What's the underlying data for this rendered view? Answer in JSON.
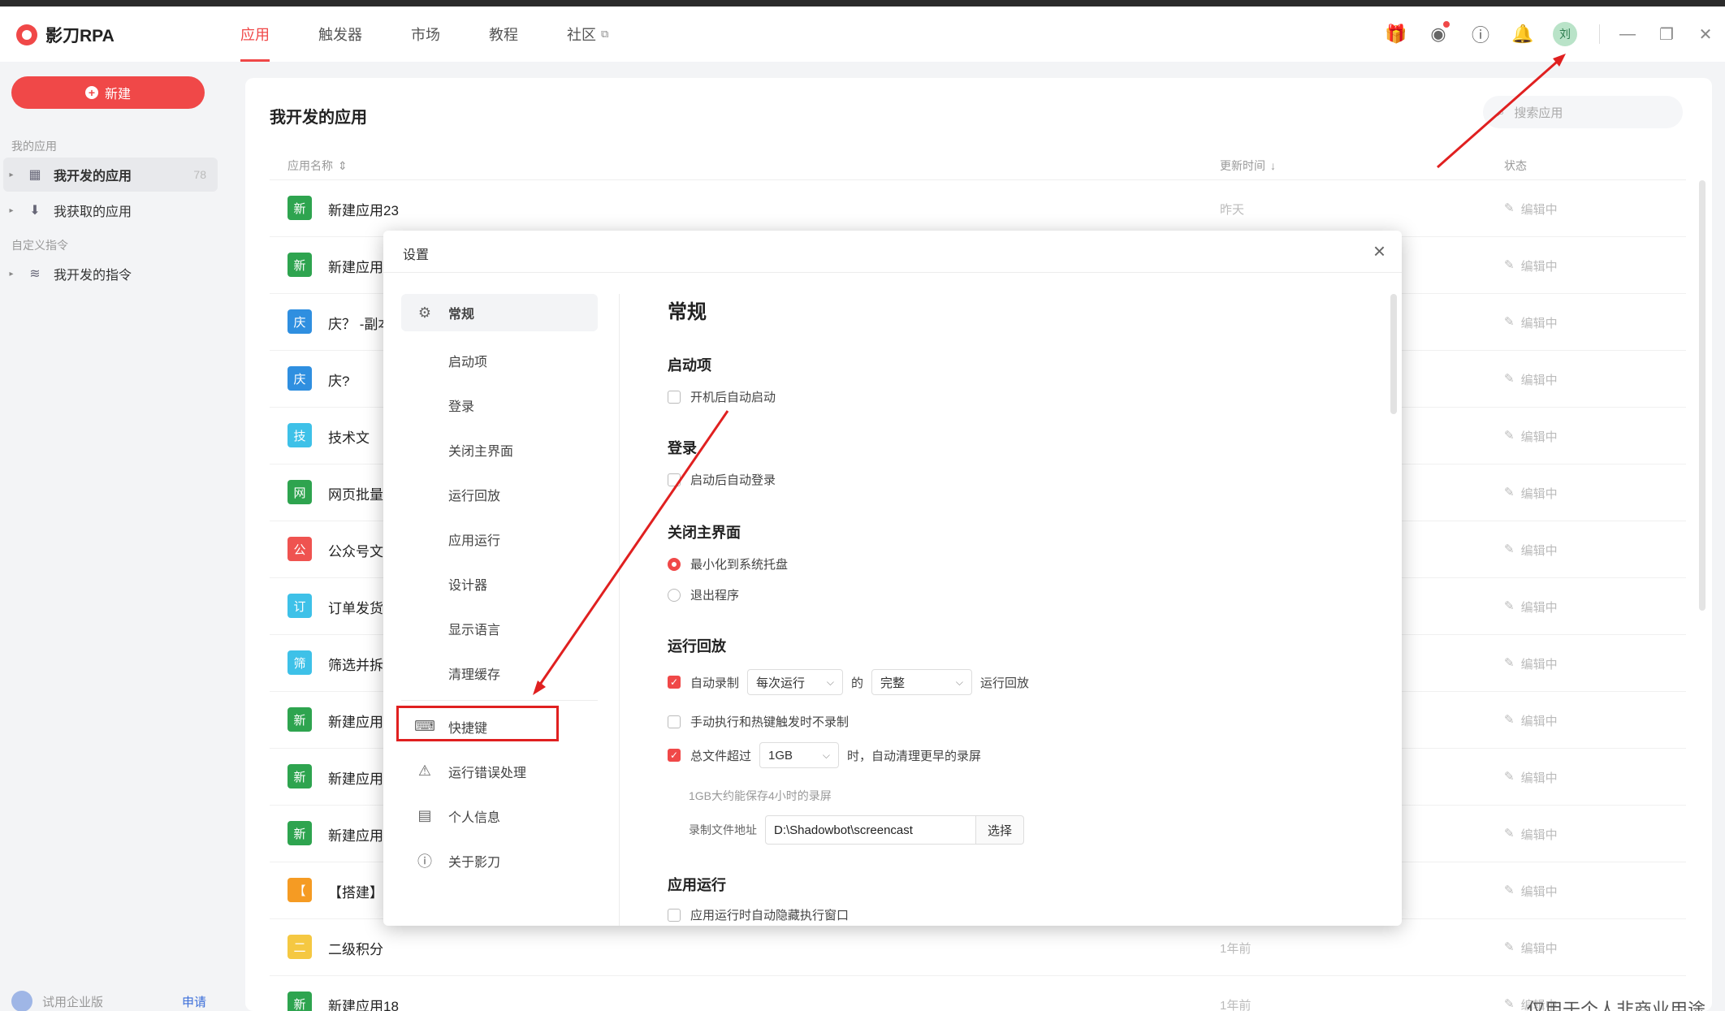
{
  "app": {
    "logo_text": "影刀RPA"
  },
  "nav": [
    {
      "label": "应用",
      "active": true
    },
    {
      "label": "触发器",
      "active": false
    },
    {
      "label": "市场",
      "active": false
    },
    {
      "label": "教程",
      "active": false
    },
    {
      "label": "社区",
      "active": false,
      "external": true
    }
  ],
  "topbar": {
    "avatar_text": "刘"
  },
  "sidebar": {
    "new_label": "新建",
    "section_my_apps": "我的应用",
    "items": [
      {
        "label": "我开发的应用",
        "count": "78",
        "active": true,
        "icon": "grid-icon"
      },
      {
        "label": "我获取的应用",
        "count": "",
        "active": false,
        "icon": "download-icon"
      }
    ],
    "section_custom": "自定义指令",
    "custom_items": [
      {
        "label": "我开发的指令",
        "icon": "layers-icon"
      }
    ],
    "trial_text": "试用企业版",
    "trial_link": "申请"
  },
  "main": {
    "title": "我开发的应用",
    "search_placeholder": "搜索应用",
    "col_name": "应用名称",
    "col_time": "更新时间",
    "col_status": "状态",
    "rows": [
      {
        "badge": "新",
        "color": "#2ea44f",
        "name": "新建应用23",
        "time": "昨天",
        "status": "编辑中"
      },
      {
        "badge": "新",
        "color": "#2ea44f",
        "name": "新建应用",
        "time": "",
        "status": "编辑中"
      },
      {
        "badge": "庆",
        "color": "#2f8fe0",
        "name": "庆？ -副本",
        "time": "",
        "status": "编辑中"
      },
      {
        "badge": "庆",
        "color": "#2f8fe0",
        "name": "庆?",
        "time": "",
        "status": "编辑中"
      },
      {
        "badge": "技",
        "color": "#3ec1e8",
        "name": "技术文",
        "time": "",
        "status": "编辑中"
      },
      {
        "badge": "网",
        "color": "#2ea44f",
        "name": "网页批量",
        "time": "",
        "status": "编辑中"
      },
      {
        "badge": "公",
        "color": "#ef5350",
        "name": "公众号文",
        "time": "",
        "status": "编辑中"
      },
      {
        "badge": "订",
        "color": "#3ec1e8",
        "name": "订单发货",
        "time": "",
        "status": "编辑中"
      },
      {
        "badge": "筛",
        "color": "#3ec1e8",
        "name": "筛选并拆",
        "time": "",
        "status": "编辑中"
      },
      {
        "badge": "新",
        "color": "#2ea44f",
        "name": "新建应用",
        "time": "",
        "status": "编辑中"
      },
      {
        "badge": "新",
        "color": "#2ea44f",
        "name": "新建应用",
        "time": "",
        "status": "编辑中"
      },
      {
        "badge": "新",
        "color": "#2ea44f",
        "name": "新建应用",
        "time": "",
        "status": "编辑中"
      },
      {
        "badge": "【",
        "color": "#f59b23",
        "name": "【搭建】",
        "time": "",
        "status": "编辑中"
      },
      {
        "badge": "二",
        "color": "#f5c842",
        "name": "二级积分",
        "time": "1年前",
        "status": "编辑中"
      },
      {
        "badge": "新",
        "color": "#2ea44f",
        "name": "新建应用18",
        "time": "1年前",
        "status": "编辑中"
      }
    ],
    "watermark": "仅用于个人非商业用途"
  },
  "modal": {
    "title": "设置",
    "nav": [
      {
        "label": "常规",
        "icon": "gear-icon",
        "type": "group",
        "selected": true
      },
      {
        "label": "启动项",
        "type": "sub"
      },
      {
        "label": "登录",
        "type": "sub"
      },
      {
        "label": "关闭主界面",
        "type": "sub"
      },
      {
        "label": "运行回放",
        "type": "sub"
      },
      {
        "label": "应用运行",
        "type": "sub"
      },
      {
        "label": "设计器",
        "type": "sub"
      },
      {
        "label": "显示语言",
        "type": "sub"
      },
      {
        "label": "清理缓存",
        "type": "sub"
      },
      {
        "label": "快捷键",
        "icon": "keyboard-icon",
        "type": "group",
        "highlighted": true
      },
      {
        "label": "运行错误处理",
        "icon": "warning-icon",
        "type": "group"
      },
      {
        "label": "个人信息",
        "icon": "id-card-icon",
        "type": "group"
      },
      {
        "label": "关于影刀",
        "icon": "info-icon",
        "type": "group"
      }
    ],
    "content": {
      "heading": "常规",
      "startup_title": "启动项",
      "startup_opt": "开机后自动启动",
      "login_title": "登录",
      "login_opt": "启动后自动登录",
      "close_title": "关闭主界面",
      "close_opt1": "最小化到系统托盘",
      "close_opt2": "退出程序",
      "replay_title": "运行回放",
      "replay_auto": "自动录制",
      "replay_sel1": "每次运行",
      "replay_of": "的",
      "replay_sel2": "完整",
      "replay_tail": "运行回放",
      "replay_manual": "手动执行和热键触发时不录制",
      "replay_size_pre": "总文件超过",
      "replay_size_sel": "1GB",
      "replay_size_post": "时，自动清理更早的录屏",
      "replay_hint": "1GB大约能保存4小时的录屏",
      "path_label": "录制文件地址",
      "path_value": "D:\\Shadowbot\\screencast",
      "path_button": "选择",
      "apprun_title": "应用运行",
      "apprun_opt": "应用运行时自动隐藏执行窗口"
    }
  },
  "colors": {
    "accent": "#f04848",
    "annotation": "#e02020"
  }
}
